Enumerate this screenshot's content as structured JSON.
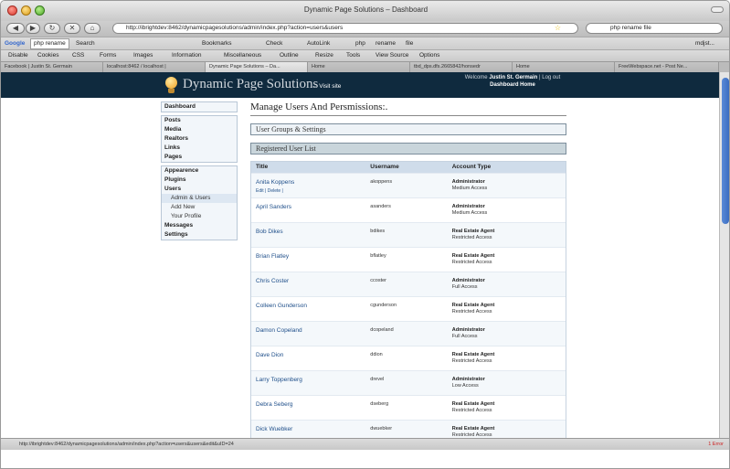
{
  "window": {
    "title": "Dynamic Page Solutions – Dashboard"
  },
  "nav": {
    "url": "http://ibrightdev:8462/dynamicpagesolutions/admin/index.php?action=users&users",
    "search_value": "php rename file"
  },
  "google_bar": {
    "items": [
      "php rename",
      "Search",
      "Bookmarks",
      "Check",
      "AutoLink",
      "php",
      "rename",
      "file",
      "mdjst..."
    ]
  },
  "webdev_bar": {
    "items": [
      "Disable",
      "Cookies",
      "CSS",
      "Forms",
      "Images",
      "Information",
      "Miscellaneous",
      "Outline",
      "Resize",
      "Tools",
      "View Source",
      "Options"
    ]
  },
  "tabs": [
    {
      "label": "Facebook | Justin St. Germain"
    },
    {
      "label": "localhost:8462 / localhost |"
    },
    {
      "label": "Dynamic Page Solutions – Da..."
    },
    {
      "label": "Home"
    },
    {
      "label": "tbd_dps.dfs.2665842/honsedr"
    },
    {
      "label": "Home"
    },
    {
      "label": "FreeWebspace.net - Post Ne..."
    }
  ],
  "site": {
    "logo": "Dynamic Page Solutions",
    "visit_site": "← Visit site",
    "welcome_prefix": "Welcome",
    "user_name": "Justin St. Germain",
    "logout": "Log out",
    "dashboard_home": "Dashboard Home"
  },
  "sidebar": {
    "dashboard": "Dashboard",
    "group1": [
      "Posts",
      "Media",
      "Realtors",
      "Links",
      "Pages"
    ],
    "group2": [
      "Appearence",
      "Plugins",
      "Users"
    ],
    "users_sub": [
      "Admin & Users",
      "Add New",
      "Your Profile"
    ],
    "group3": [
      "Messages",
      "Settings"
    ]
  },
  "main": {
    "title": "Manage Users And Persmissions:.",
    "panel1": "User Groups & Settings",
    "panel2": "Registered User List",
    "columns": [
      "Title",
      "Username",
      "Account Type"
    ],
    "edit": "Edit",
    "delete": "Delete",
    "users": [
      {
        "name": "Anita Koppens",
        "username": "akoppens",
        "type": "Administrator",
        "level": "Medium Access"
      },
      {
        "name": "April Sanders",
        "username": "asanders",
        "type": "Administrator",
        "level": "Medium Access"
      },
      {
        "name": "Bob Dikes",
        "username": "bdikes",
        "type": "Real Estate Agent",
        "level": "Restricted Access"
      },
      {
        "name": "Brian Flatley",
        "username": "bflatley",
        "type": "Real Estate Agent",
        "level": "Restricted Access"
      },
      {
        "name": "Chris Coster",
        "username": "ccoster",
        "type": "Administrator",
        "level": "Full Access"
      },
      {
        "name": "Colleen Gunderson",
        "username": "cgunderson",
        "type": "Real Estate Agent",
        "level": "Restricted Access"
      },
      {
        "name": "Damon Copeland",
        "username": "dcopeland",
        "type": "Administrator",
        "level": "Full Access"
      },
      {
        "name": "Dave Dion",
        "username": "ddion",
        "type": "Real Estate Agent",
        "level": "Restricted Access"
      },
      {
        "name": "Larry Toppenberg",
        "username": "drevel",
        "type": "Administrator",
        "level": "Low Access"
      },
      {
        "name": "Debra Seberg",
        "username": "dseberg",
        "type": "Real Estate Agent",
        "level": "Restricted Access"
      },
      {
        "name": "Dick Wuebker",
        "username": "dwuebker",
        "type": "Real Estate Agent",
        "level": "Restricted Access"
      }
    ]
  },
  "status": {
    "url": "http://ibrightdev:8462/dynamicpagesolutions/admin/index.php?action=users&users&edit&uID=24",
    "error": "1 Error"
  }
}
